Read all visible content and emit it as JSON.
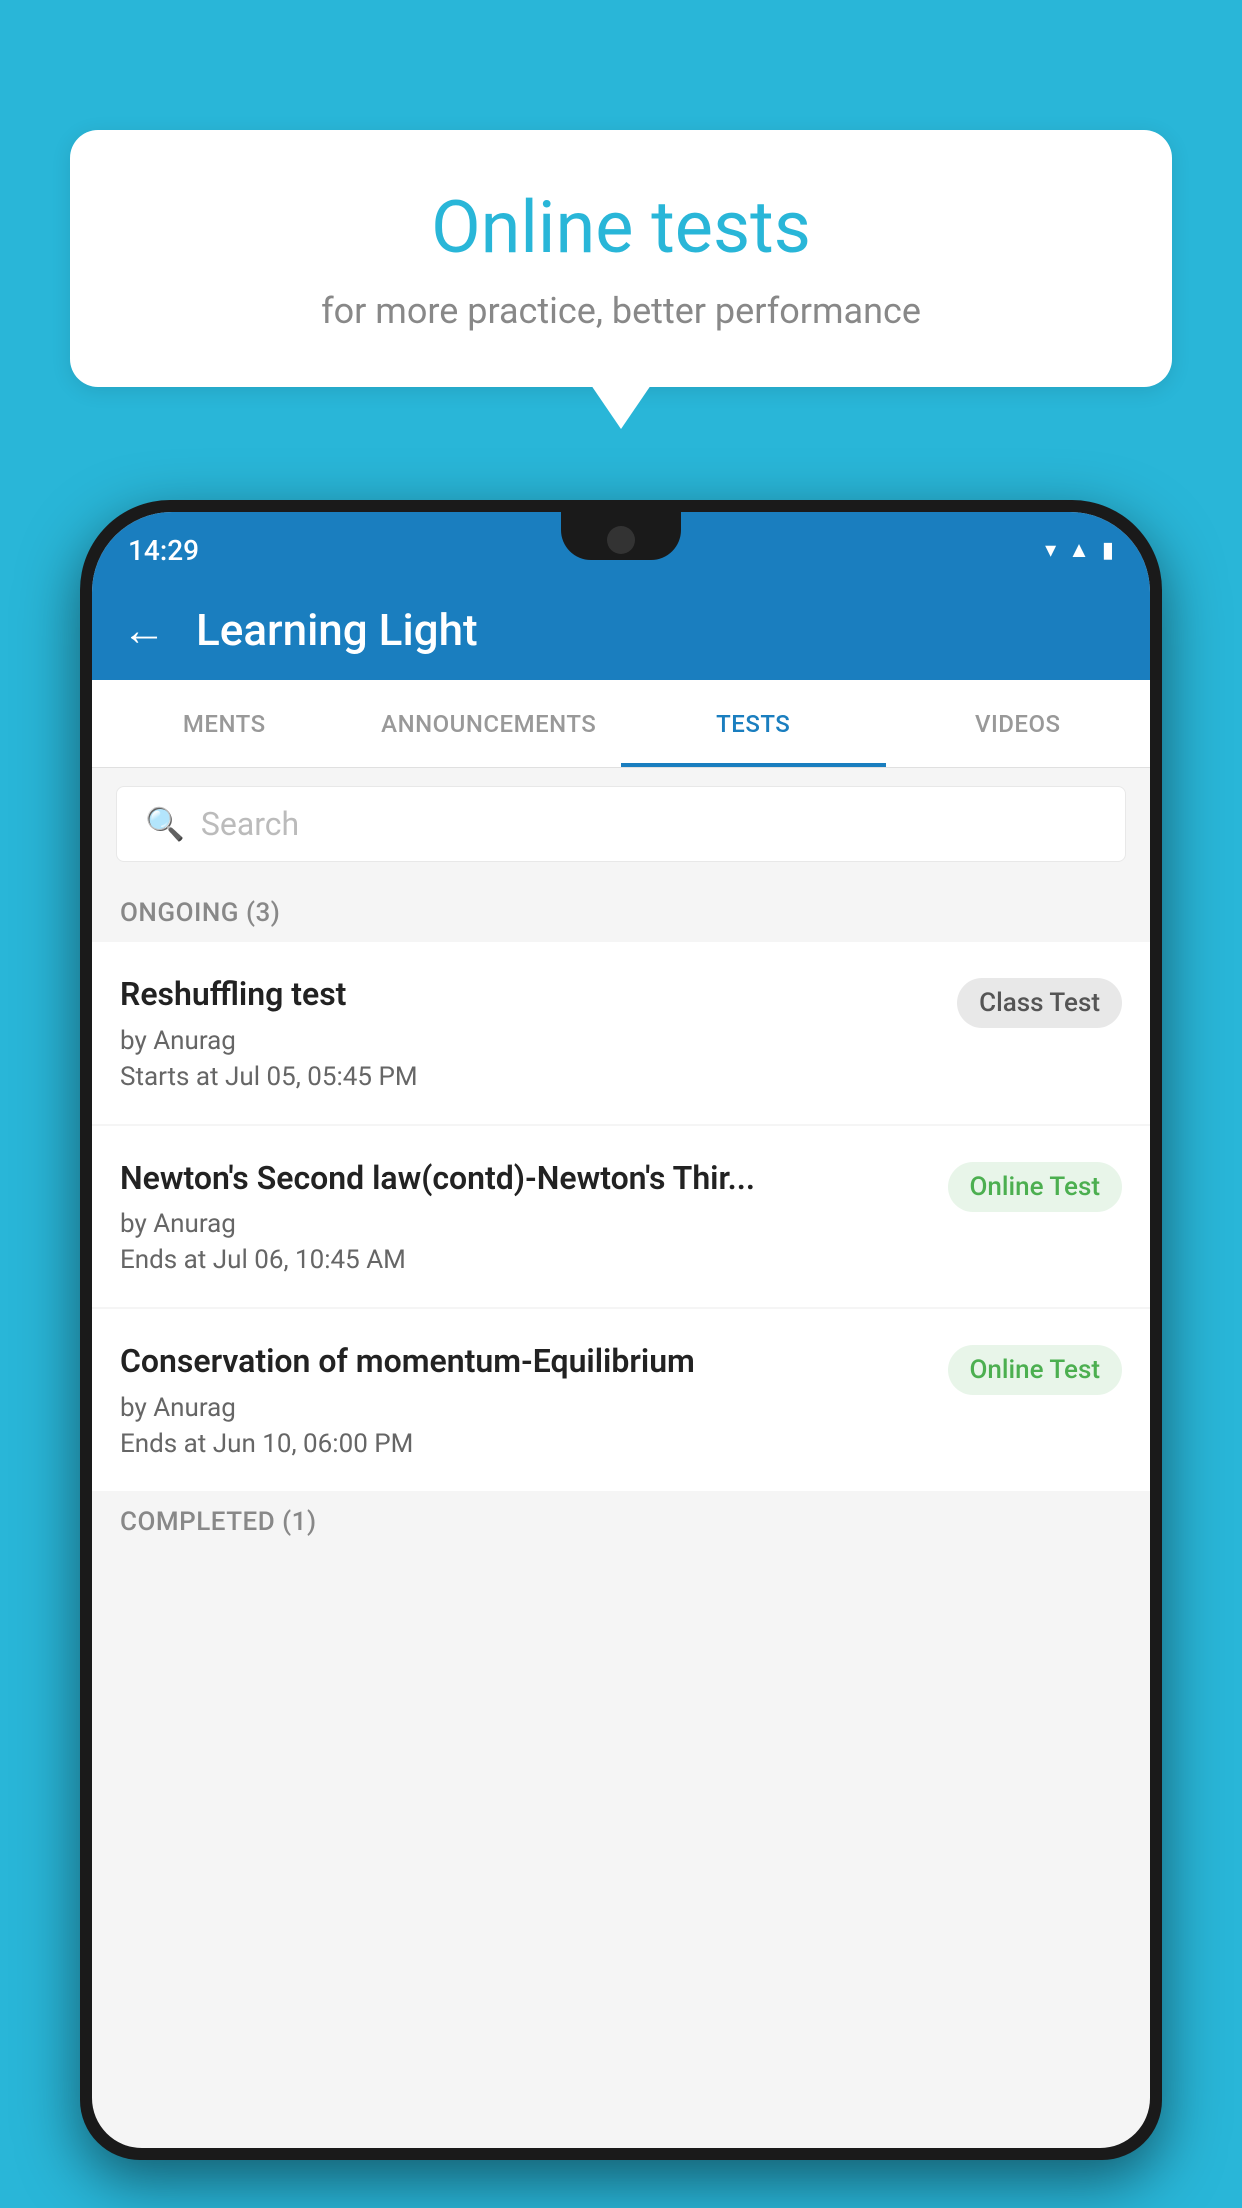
{
  "background": {
    "color": "#29b6d8"
  },
  "speech_bubble": {
    "title": "Online tests",
    "subtitle": "for more practice, better performance"
  },
  "status_bar": {
    "time": "14:29",
    "icons": [
      "wifi",
      "signal",
      "battery"
    ]
  },
  "app_header": {
    "back_label": "←",
    "title": "Learning Light"
  },
  "tabs": [
    {
      "label": "MENTS",
      "active": false
    },
    {
      "label": "ANNOUNCEMENTS",
      "active": false
    },
    {
      "label": "TESTS",
      "active": true
    },
    {
      "label": "VIDEOS",
      "active": false
    }
  ],
  "search": {
    "placeholder": "Search"
  },
  "ongoing_section": {
    "label": "ONGOING (3)"
  },
  "tests": [
    {
      "title": "Reshuffling test",
      "author": "by Anurag",
      "time_label": "Starts at",
      "time": "Jul 05, 05:45 PM",
      "badge": "Class Test",
      "badge_type": "class"
    },
    {
      "title": "Newton's Second law(contd)-Newton's Thir...",
      "author": "by Anurag",
      "time_label": "Ends at",
      "time": "Jul 06, 10:45 AM",
      "badge": "Online Test",
      "badge_type": "online"
    },
    {
      "title": "Conservation of momentum-Equilibrium",
      "author": "by Anurag",
      "time_label": "Ends at",
      "time": "Jun 10, 06:00 PM",
      "badge": "Online Test",
      "badge_type": "online"
    }
  ],
  "completed_section": {
    "label": "COMPLETED (1)"
  }
}
